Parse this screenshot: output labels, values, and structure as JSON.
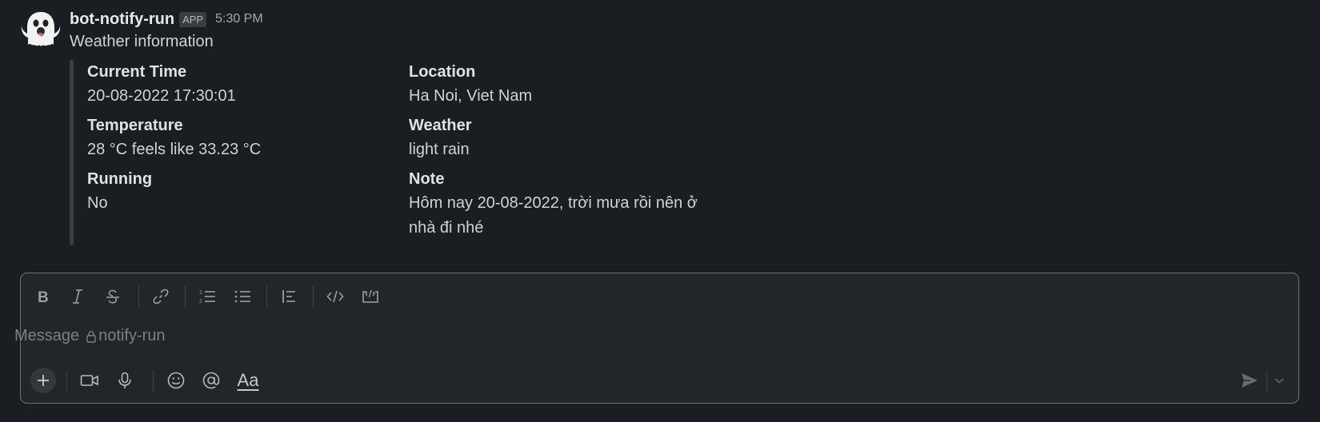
{
  "message": {
    "sender": "bot-notify-run",
    "badge": "APP",
    "timestamp": "5:30 PM",
    "text": "Weather information",
    "fields": [
      {
        "title": "Current Time",
        "value": "20-08-2022 17:30:01"
      },
      {
        "title": "Location",
        "value": "Ha Noi, Viet Nam"
      },
      {
        "title": "Temperature",
        "value": "28 °C feels like 33.23 °C"
      },
      {
        "title": "Weather",
        "value": "light rain"
      },
      {
        "title": "Running",
        "value": "No"
      },
      {
        "title": "Note",
        "value": "Hôm nay 20-08-2022, trời mưa rồi nên ở nhà đi nhé"
      }
    ]
  },
  "composer": {
    "placeholder_prefix": "Message",
    "channel": "notify-run",
    "format_toolbar": [
      "bold-icon",
      "italic-icon",
      "strikethrough-icon",
      "link-icon",
      "ordered-list-icon",
      "bulleted-list-icon",
      "blockquote-icon",
      "code-icon",
      "code-block-icon"
    ],
    "actions": [
      "plus-icon",
      "video-icon",
      "microphone-icon",
      "emoji-icon",
      "mention-icon",
      "format-text-icon",
      "send-icon",
      "chevron-down-icon"
    ],
    "format_label": "Aa"
  }
}
